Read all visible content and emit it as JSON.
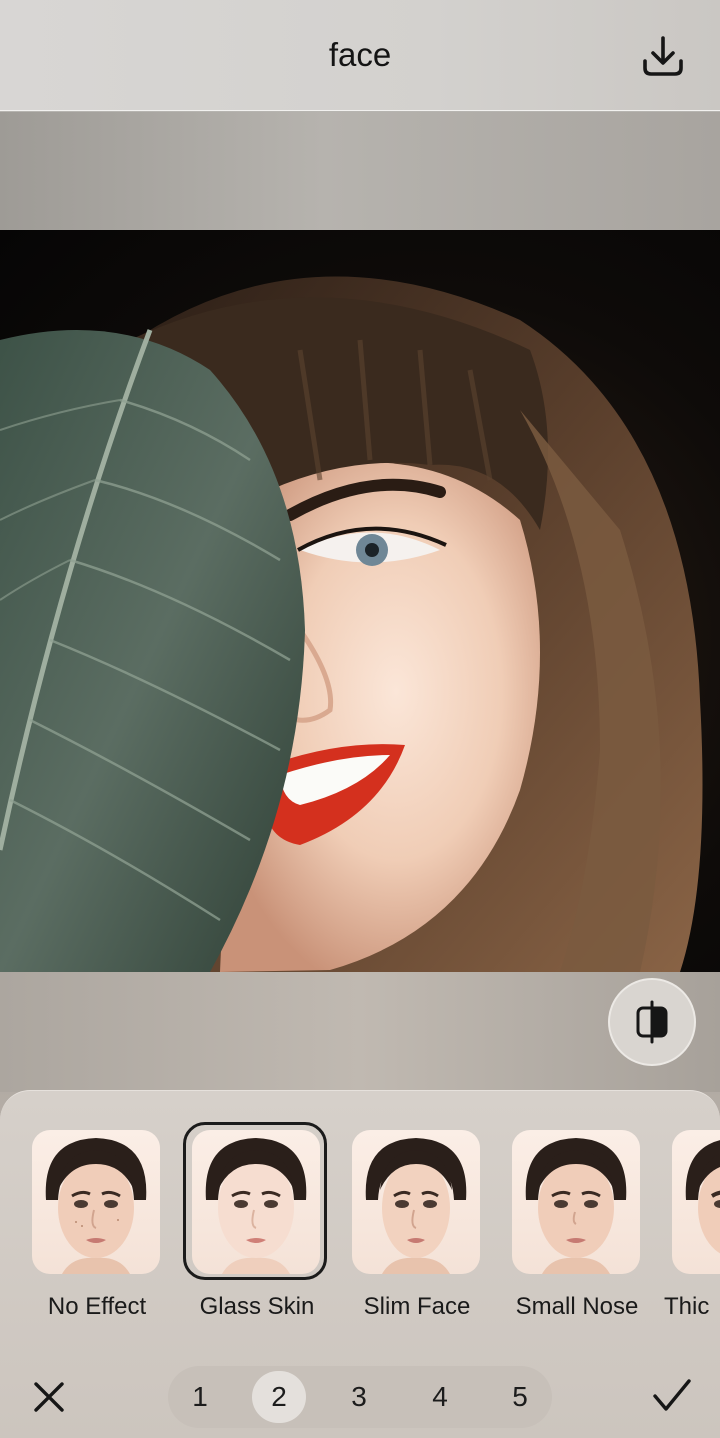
{
  "header": {
    "title": "face",
    "download_icon": "download-icon"
  },
  "compare_icon": "compare-icon",
  "effects": [
    {
      "label": "No Effect",
      "selected": false
    },
    {
      "label": "Glass Skin",
      "selected": true
    },
    {
      "label": "Slim Face",
      "selected": false
    },
    {
      "label": "Small Nose",
      "selected": false
    },
    {
      "label": "Thic",
      "selected": false
    }
  ],
  "levels": {
    "items": [
      "1",
      "2",
      "3",
      "4",
      "5"
    ],
    "selected": "2"
  },
  "actions": {
    "close_icon": "close-icon",
    "confirm_icon": "checkmark-icon"
  }
}
